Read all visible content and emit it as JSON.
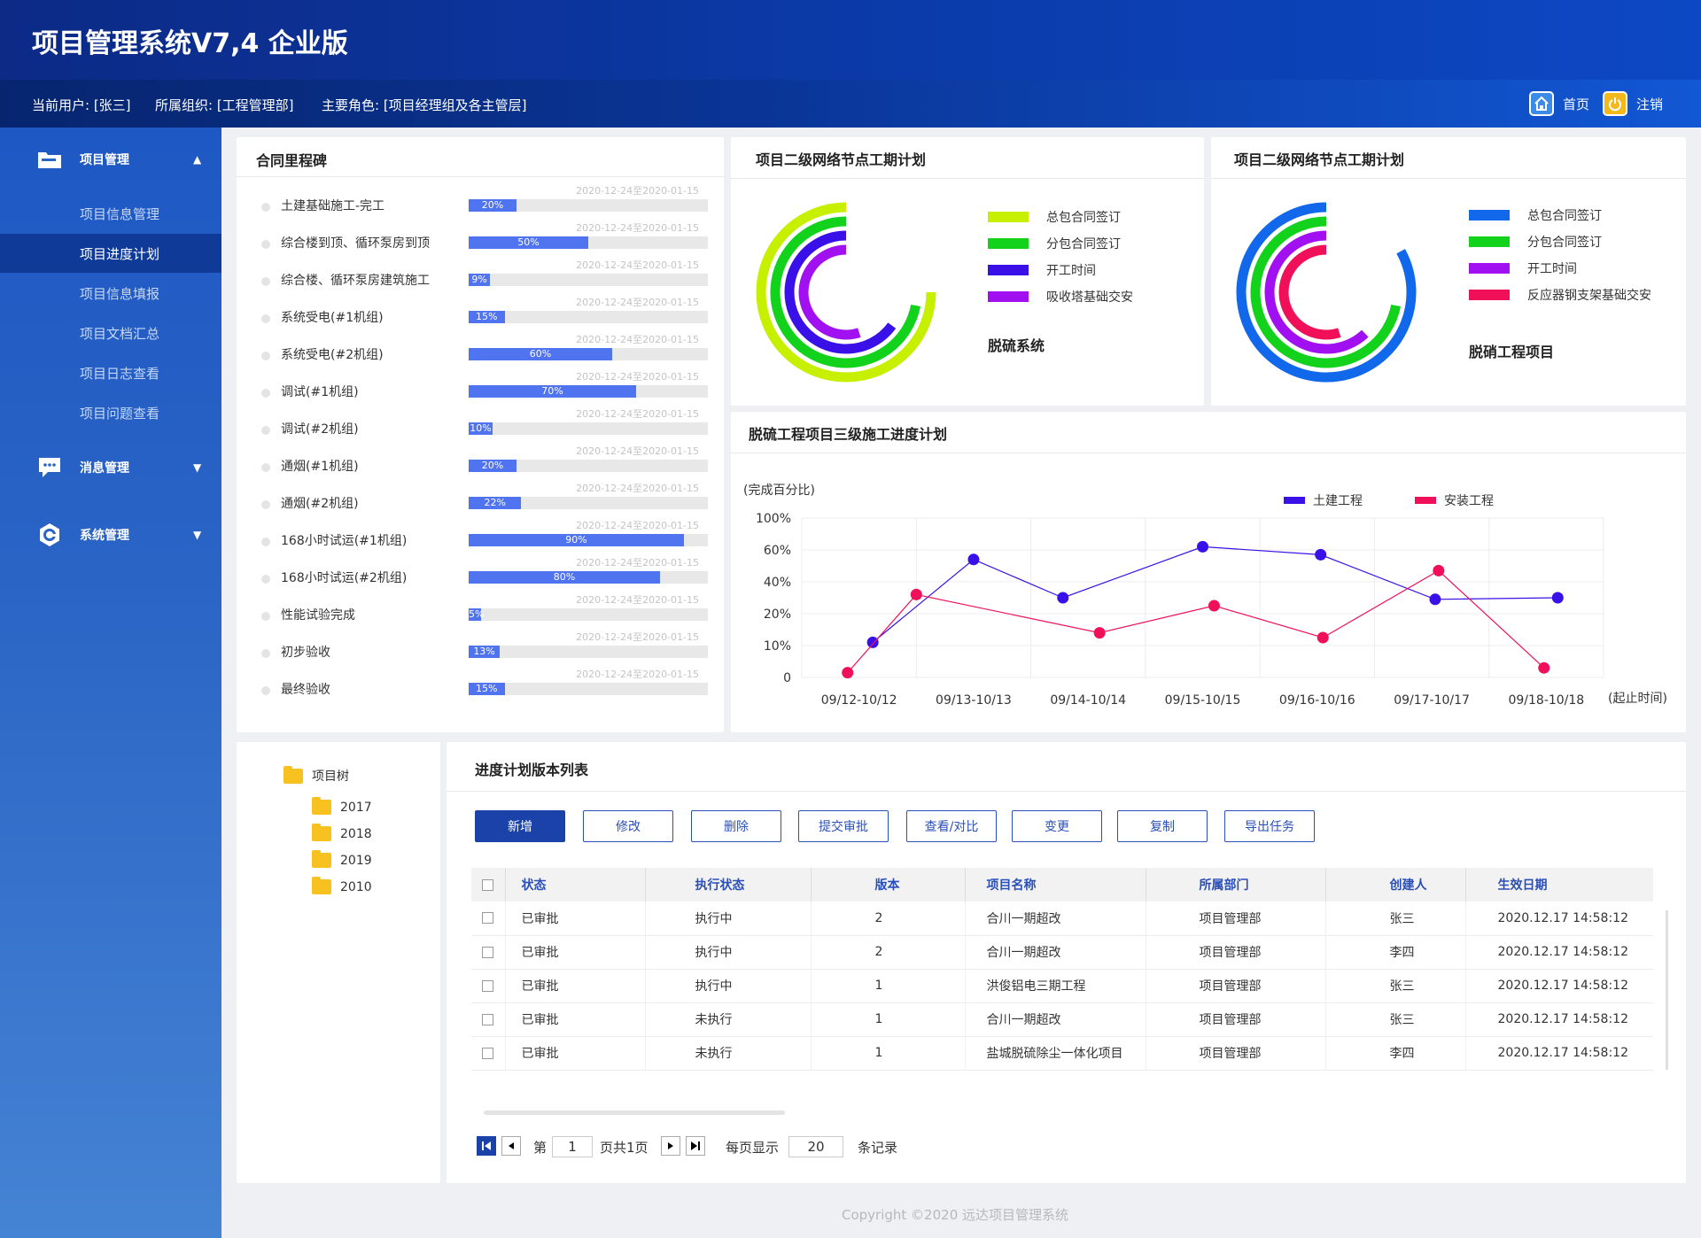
{
  "app": {
    "title": "项目管理系统V7,4   企业版"
  },
  "info": {
    "user": "当前用户: [张三]",
    "org": "所属组织: [工程管理部]",
    "role": "主要角色: [项目经理组及各主管层]"
  },
  "header_actions": {
    "home": "首页",
    "logout": "注销"
  },
  "sidebar": {
    "groups": [
      {
        "label": "项目管理",
        "icon": "folder-icon",
        "expanded": true
      },
      {
        "label": "消息管理",
        "icon": "chat-icon",
        "expanded": false
      },
      {
        "label": "系统管理",
        "icon": "gear-icon",
        "expanded": false
      }
    ],
    "items": [
      {
        "label": "项目信息管理",
        "active": false
      },
      {
        "label": "项目进度计划",
        "active": true
      },
      {
        "label": "项目信息填报",
        "active": false
      },
      {
        "label": "项目文档汇总",
        "active": false
      },
      {
        "label": "项目日志查看",
        "active": false
      },
      {
        "label": "项目问题查看",
        "active": false
      }
    ]
  },
  "milestones": {
    "title": "合同里程碑",
    "date_range": "2020-12-24至2020-01-15",
    "rows": [
      {
        "label": "土建基础施工-完工",
        "pct": 20
      },
      {
        "label": "综合楼到顶、循环泵房到顶",
        "pct": 50
      },
      {
        "label": "综合楼、循环泵房建筑施工",
        "pct": 9
      },
      {
        "label": "系统受电(#1机组)",
        "pct": 15
      },
      {
        "label": "系统受电(#2机组)",
        "pct": 60
      },
      {
        "label": "调试(#1机组)",
        "pct": 70
      },
      {
        "label": "调试(#2机组)",
        "pct": 10
      },
      {
        "label": "通烟(#1机组)",
        "pct": 20
      },
      {
        "label": "通烟(#2机组)",
        "pct": 22
      },
      {
        "label": "168小时试运(#1机组)",
        "pct": 90
      },
      {
        "label": "168小时试运(#2机组)",
        "pct": 80
      },
      {
        "label": "性能试验完成",
        "pct": 5
      },
      {
        "label": "初步验收",
        "pct": 13
      },
      {
        "label": "最终验收",
        "pct": 15
      }
    ]
  },
  "ring1": {
    "title": "项目二级网络节点工期计划",
    "name": "脱硫系统",
    "items": [
      {
        "label": "总包合同签订",
        "color": "#c6f000",
        "value": 0.75
      },
      {
        "label": "分包合同签订",
        "color": "#12d21c",
        "value": 0.72
      },
      {
        "label": "开工时间",
        "color": "#3a10e8",
        "value": 0.65
      },
      {
        "label": "吸收塔基础交安",
        "color": "#a010f0",
        "value": 0.55
      }
    ]
  },
  "ring2": {
    "title": "项目二级网络节点工期计划",
    "name": "脱硝工程项目",
    "items": [
      {
        "label": "总包合同签订",
        "color": "#1168ea",
        "value": 0.83
      },
      {
        "label": "分包合同签订",
        "color": "#12d21c",
        "value": 0.72
      },
      {
        "label": "开工时间",
        "color": "#a010f0",
        "value": 0.62
      },
      {
        "label": "反应器钢支架基础交安",
        "color": "#f0105a",
        "value": 0.55
      }
    ]
  },
  "line_chart": {
    "title": "脱硫工程项目三级施工进度计划",
    "ylabel": "(完成百分比)",
    "xlabel": "(起止时间)"
  },
  "chart_data": {
    "type": "line",
    "categories": [
      "09/12-10/12",
      "09/13-10/13",
      "09/14-10/14",
      "09/15-10/15",
      "09/16-10/16",
      "09/17-10/17",
      "09/18-10/18"
    ],
    "y_ticks": [
      "0",
      "10%",
      "20%",
      "40%",
      "60%",
      "100%"
    ],
    "series": [
      {
        "name": "土建工程",
        "color": "#3a10e8",
        "points": [
          [
            0.12,
            1.1
          ],
          [
            1.0,
            3.7
          ],
          [
            1.78,
            2.5
          ],
          [
            3.0,
            4.1
          ],
          [
            4.03,
            3.85
          ],
          [
            5.03,
            2.45
          ],
          [
            6.1,
            2.5
          ]
        ]
      },
      {
        "name": "安装工程",
        "color": "#f0105a",
        "points": [
          [
            -0.1,
            0.15
          ],
          [
            0.5,
            2.6
          ],
          [
            2.1,
            1.4
          ],
          [
            3.1,
            2.25
          ],
          [
            4.05,
            1.25
          ],
          [
            5.06,
            3.35
          ],
          [
            5.98,
            0.3
          ]
        ]
      }
    ],
    "grid": true,
    "legend": "top"
  },
  "tree": {
    "root": "项目树",
    "children": [
      "2017",
      "2018",
      "2019",
      "2010"
    ]
  },
  "version_list": {
    "title": "进度计划版本列表",
    "buttons": [
      "新增",
      "修改",
      "删除",
      "提交审批",
      "查看/对比",
      "变更",
      "复制",
      "导出任务"
    ],
    "columns": [
      "状态",
      "执行状态",
      "版本",
      "项目名称",
      "所属部门",
      "创建人",
      "生效日期"
    ],
    "rows": [
      [
        "已审批",
        "执行中",
        "2",
        "合川一期超改",
        "项目管理部",
        "张三",
        "2020.12.17 14:58:12"
      ],
      [
        "已审批",
        "执行中",
        "2",
        "合川一期超改",
        "项目管理部",
        "李四",
        "2020.12.17 14:58:12"
      ],
      [
        "已审批",
        "执行中",
        "1",
        "洪俊铝电三期工程",
        "项目管理部",
        "张三",
        "2020.12.17 14:58:12"
      ],
      [
        "已审批",
        "未执行",
        "1",
        "合川一期超改",
        "项目管理部",
        "张三",
        "2020.12.17 14:58:12"
      ],
      [
        "已审批",
        "未执行",
        "1",
        "盐城脱硫除尘一体化项目",
        "项目管理部",
        "李四",
        "2020.12.17 14:58:12"
      ]
    ]
  },
  "pager": {
    "page_prefix": "第",
    "page": "1",
    "total": "页共1页",
    "per_page_label": "每页显示",
    "per_page": "20",
    "records": "条记录"
  },
  "footer": "Copyright ©2020 远达项目管理系统"
}
